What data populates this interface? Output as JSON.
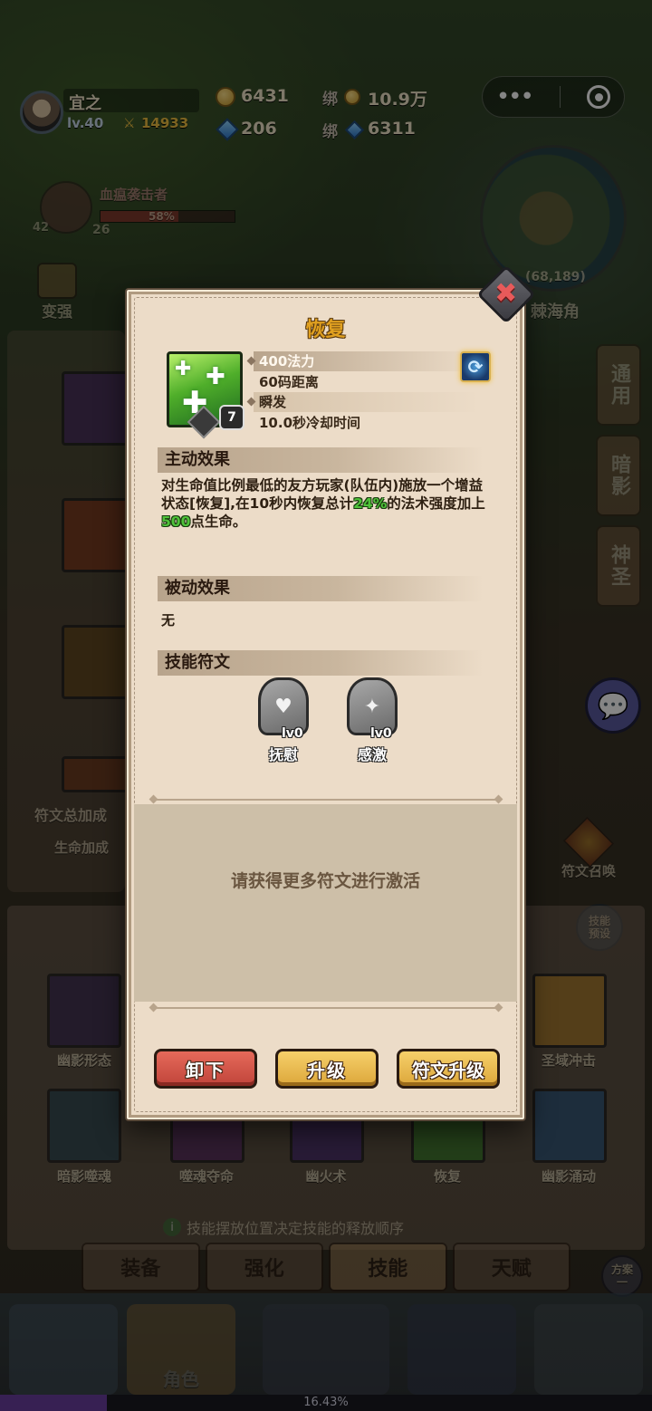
{
  "player": {
    "name": "宜之",
    "level": "lv.40",
    "power": "14933",
    "gold": "6431",
    "diamonds": "206",
    "bound_gold_label": "绑",
    "bound_gold": "10.9万",
    "bound_diamond_label": "绑",
    "bound_diamond": "6311"
  },
  "capsule": {
    "more_icon": "more-dots-icon",
    "record_icon": "target-icon"
  },
  "enemy": {
    "name": "血瘟袭击者",
    "hp_percent": "58%",
    "count": "26",
    "level": "42"
  },
  "map": {
    "coords": "(68,189)",
    "zone": "棘海角"
  },
  "background": {
    "left_button": "变强",
    "rune_total": "符文总加成",
    "hp_bonus": "生命加成",
    "right_tabs": [
      "通用",
      "暗影",
      "神圣"
    ],
    "rune_summon": "符文召唤",
    "skill_preset": "技能预设",
    "skills": [
      {
        "label": "幽影形态",
        "color": "#3a2a5a"
      },
      {
        "label": "圣域冲击",
        "color": "#c08a2a"
      },
      {
        "label": "暗影噬魂",
        "color": "#2a4a5a"
      },
      {
        "label": "噬魂夺命",
        "color": "#5a2a6a"
      },
      {
        "label": "幽火术",
        "color": "#4a2a7a"
      },
      {
        "label": "恢复",
        "color": "#3a8a2a"
      },
      {
        "label": "幽影涌动",
        "color": "#2a5a8a"
      }
    ],
    "hint": "技能摆放位置决定技能的释放顺序",
    "bottom_tabs": [
      "装备",
      "强化",
      "技能",
      "天赋"
    ],
    "plan_label": "方案一",
    "nav_role": "角色",
    "xp_percent": "16.43%",
    "xp_fraction": 0.1643
  },
  "dialog": {
    "title": "恢复",
    "skill_level": "7",
    "stats": [
      "400法力",
      "60码距离",
      "瞬发",
      "10.0秒冷却时间"
    ],
    "swap_icon": "swap-icon",
    "active_header": "主动效果",
    "active_desc_1": "对生命值比例最低的友方玩家(队伍内)施放一个增益状态[恢复],在10秒内恢复总计",
    "active_pct": "24%",
    "active_desc_2": "的法术强度加上",
    "active_amount": "500",
    "active_desc_3": "点生命。",
    "passive_header": "被动效果",
    "passive_text": "无",
    "runes_header": "技能符文",
    "runes": [
      {
        "name": "抚慰",
        "level": "lv0",
        "glyph": "♥"
      },
      {
        "name": "感激",
        "level": "lv0",
        "glyph": "✦"
      }
    ],
    "inactive_text": "请获得更多符文进行激活",
    "buttons": {
      "unequip": "卸下",
      "upgrade": "升级",
      "rune_upgrade": "符文升级"
    }
  }
}
